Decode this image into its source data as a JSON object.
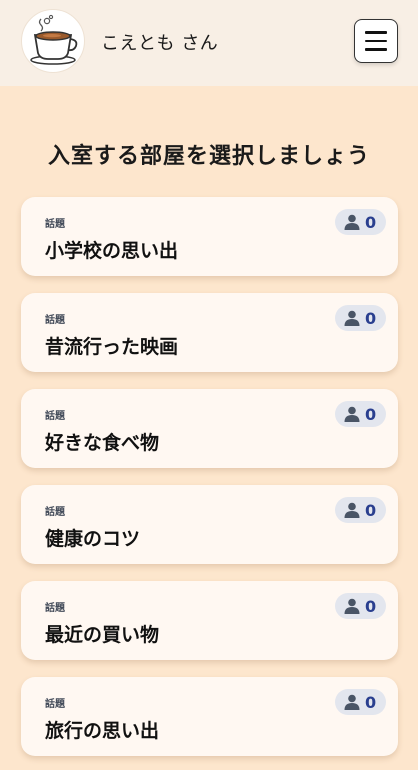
{
  "header": {
    "username": "こえとも さん",
    "avatar_icon": "coffee-cup-icon",
    "menu_icon": "hamburger-menu-icon"
  },
  "main": {
    "title": "入室する部屋を選択しましょう",
    "rooms": [
      {
        "category": "話題",
        "name": "小学校の思い出",
        "count": "0"
      },
      {
        "category": "話題",
        "name": "昔流行った映画",
        "count": "0"
      },
      {
        "category": "話題",
        "name": "好きな食べ物",
        "count": "0"
      },
      {
        "category": "話題",
        "name": "健康のコツ",
        "count": "0"
      },
      {
        "category": "話題",
        "name": "最近の買い物",
        "count": "0"
      },
      {
        "category": "話題",
        "name": "旅行の思い出",
        "count": "0"
      }
    ]
  },
  "colors": {
    "page_background": "#fde6cd",
    "header_background": "#f8efe5",
    "card_background": "#fff8f2",
    "badge_background": "#e3e6ee",
    "badge_text": "#2a3f8f"
  }
}
